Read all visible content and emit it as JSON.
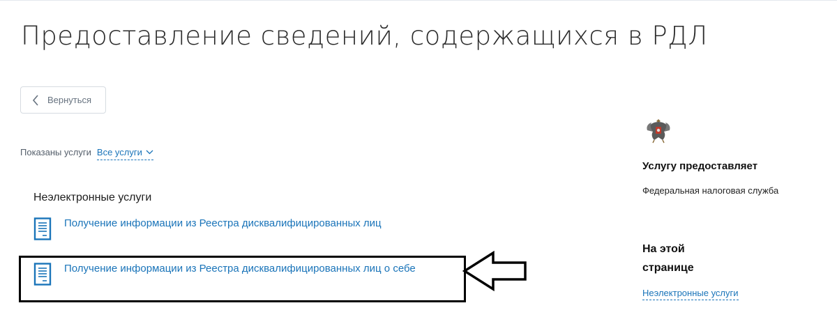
{
  "page": {
    "title": "Предоставление сведений, содержащихся в РДЛ"
  },
  "back_button": {
    "label": "Вернуться",
    "icon": "chevron-left-icon"
  },
  "filter": {
    "label": "Показаны услуги",
    "value": "Все услуги",
    "icon": "chevron-down-icon"
  },
  "section": {
    "title": "Неэлектронные услуги",
    "services": [
      {
        "label": "Получение информации из Реестра дисквалифицированных лиц",
        "icon": "document-icon"
      },
      {
        "label": "Получение информации из Реестра дисквалифицированных лиц о себе",
        "icon": "document-icon"
      }
    ]
  },
  "sidebar": {
    "emblem": "russian-coat-of-arms-icon",
    "provider_heading": "Услугу предоставляет",
    "provider_name": "Федеральная налоговая служба",
    "on_page_heading_line1": "На этой",
    "on_page_heading_line2": "странице",
    "anchor_link": "Неэлектронные услуги"
  },
  "colors": {
    "link": "#1a74b9",
    "annotation": "#000000"
  }
}
